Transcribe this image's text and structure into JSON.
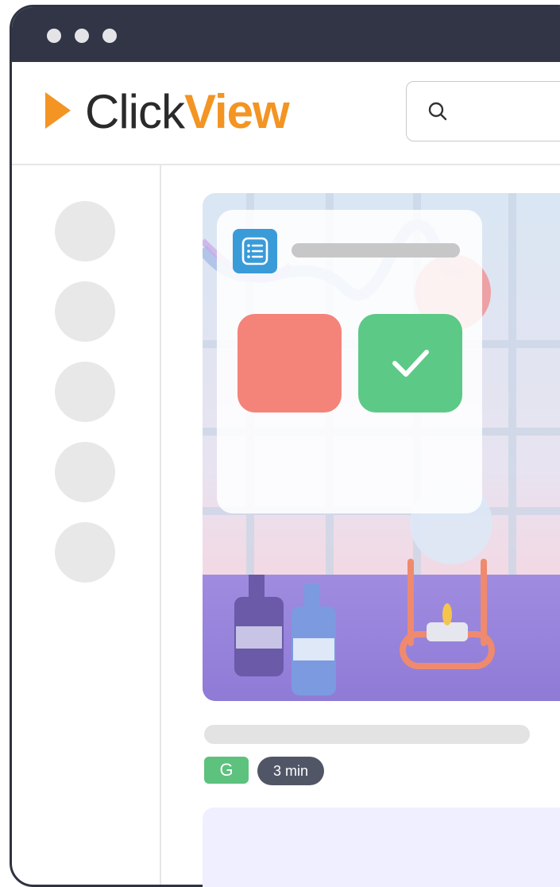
{
  "window": {
    "controls": [
      "close",
      "minimize",
      "maximize"
    ],
    "titlebar_color": "#313545"
  },
  "header": {
    "logo": {
      "word_a": "Click",
      "word_b": "View",
      "accent": "#f39423",
      "icon": "play-triangle-icon"
    },
    "search": {
      "icon": "search-icon",
      "placeholder": "",
      "value": ""
    }
  },
  "sidebar": {
    "items": [
      {
        "icon": "placeholder-circle"
      },
      {
        "icon": "placeholder-circle"
      },
      {
        "icon": "placeholder-circle"
      },
      {
        "icon": "placeholder-circle"
      },
      {
        "icon": "placeholder-circle"
      }
    ]
  },
  "video": {
    "quiz": {
      "icon": "list-icon",
      "answers": [
        {
          "state": "incorrect",
          "color": "#f4837a"
        },
        {
          "state": "correct",
          "color": "#5cc987",
          "icon": "check-icon"
        }
      ]
    },
    "rating": "G",
    "duration": "3 min"
  }
}
